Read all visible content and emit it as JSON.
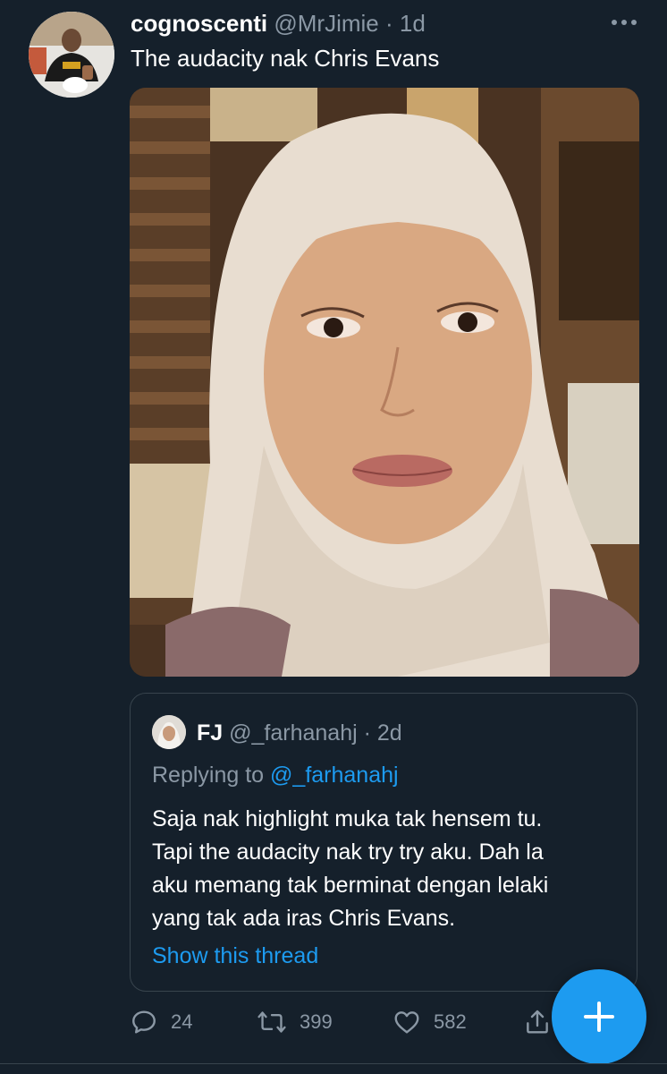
{
  "colors": {
    "background": "#15202b",
    "secondary_text": "#8b98a5",
    "accent": "#1d9bf0",
    "border": "#38444d"
  },
  "tweet": {
    "display_name": "cognoscenti",
    "handle": "@MrJimie",
    "separator": "·",
    "time": "1d",
    "text": "The audacity nak Chris Evans",
    "more_icon": "more-horizontal-icon",
    "photo_alt": "photo"
  },
  "quoted_tweet": {
    "display_name": "FJ",
    "handle": "@_farhanahj",
    "separator": "·",
    "time": "2d",
    "replying_label": "Replying to",
    "replying_handle": "@_farhanahj",
    "text_lines": [
      "Saja nak highlight muka tak hensem tu.",
      "Tapi the audacity nak try try aku. Dah la",
      "aku memang tak berminat dengan lelaki",
      "yang tak ada iras Chris Evans."
    ],
    "show_thread": "Show this thread"
  },
  "actions": {
    "reply_count": "24",
    "retweet_count": "399",
    "like_count": "582",
    "icons": [
      "reply-icon",
      "retweet-icon",
      "like-icon",
      "share-icon"
    ]
  },
  "fab": {
    "icon": "compose-plus-icon"
  }
}
